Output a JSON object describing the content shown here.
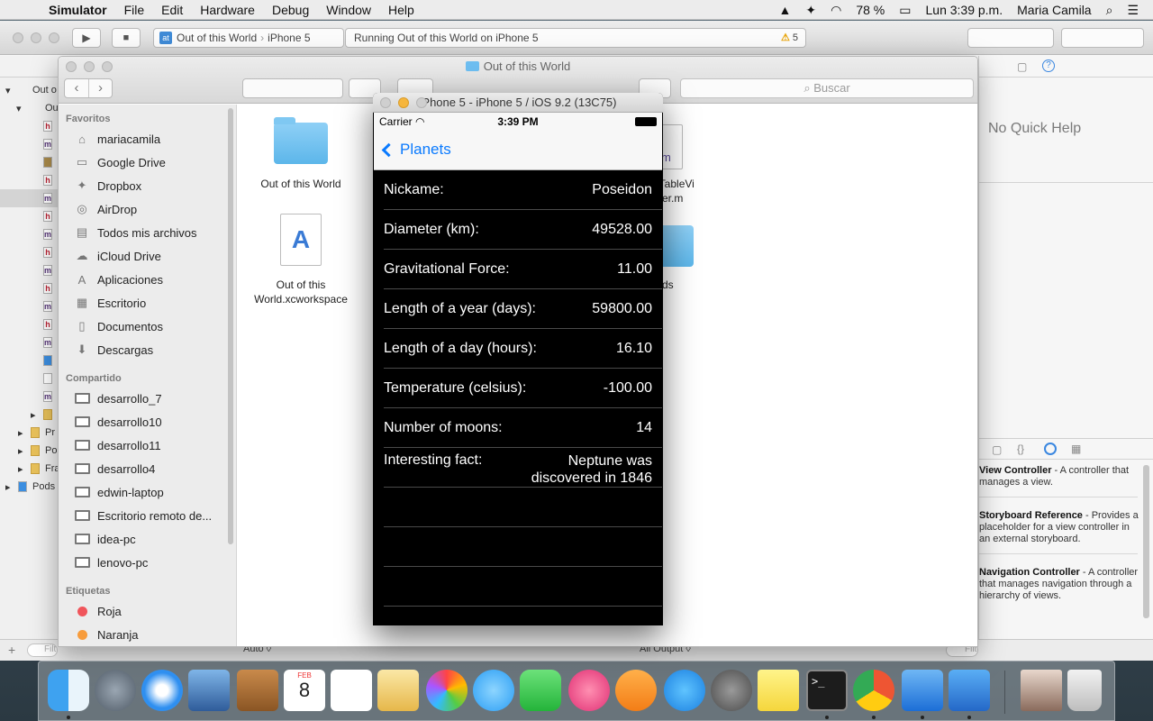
{
  "menubar": {
    "app": "Simulator",
    "items": [
      "File",
      "Edit",
      "Hardware",
      "Debug",
      "Window",
      "Help"
    ],
    "battery": "78 %",
    "clock": "Lun 3:39 p.m.",
    "user": "Maria Camila"
  },
  "xcode": {
    "scheme_target": "Out of this World",
    "scheme_device": "iPhone 5",
    "activity": "Running Out of this World on iPhone 5",
    "warnings": "5",
    "nav_labels": [
      "Out o",
      "Ou",
      "Pr",
      "Po",
      "Fra",
      "Pods"
    ],
    "quick_help": "No Quick Help",
    "filter_placeholder": "Filter",
    "bottom_auto": "Auto ◊",
    "bottom_output": "All Output ◊",
    "library": [
      {
        "title": "View Controller",
        "desc": " - A controller that manages a view."
      },
      {
        "title": "Storyboard Reference",
        "desc": " - Provides a placeholder for a view controller in an external storyboard."
      },
      {
        "title": "Navigation Controller",
        "desc": " - A controller that manages navigation through a hierarchy of views."
      }
    ]
  },
  "finder": {
    "title": "Out of this World",
    "search_placeholder": "Buscar",
    "sections": {
      "favorites": "Favoritos",
      "shared": "Compartido",
      "tags": "Etiquetas"
    },
    "favorites": [
      "mariacamila",
      "Google Drive",
      "Dropbox",
      "AirDrop",
      "Todos mis archivos",
      "iCloud Drive",
      "Aplicaciones",
      "Escritorio",
      "Documentos",
      "Descargas"
    ],
    "shared": [
      "desarrollo_7",
      "desarrollo10",
      "desarrollo11",
      "desarrollo4",
      "edwin-laptop",
      "Escritorio remoto de...",
      "idea-pc",
      "lenovo-pc"
    ],
    "tags": [
      "Roja",
      "Naranja"
    ],
    "files": {
      "folder1": "Out of this World",
      "workspace_line1": "Out of this",
      "workspace_line2": "World.xcworkspace",
      "partial_file_line1": "ceTableVi",
      "partial_file_line2": "roller.m",
      "partial_folder": "ds",
      "partial_m": "m"
    }
  },
  "simulator": {
    "title": "iPhone 5 - iPhone 5 / iOS 9.2 (13C75)",
    "carrier": "Carrier",
    "time": "3:39 PM",
    "back_label": "Planets",
    "rows": [
      {
        "key": "Nickame:",
        "value": "Poseidon"
      },
      {
        "key": "Diameter (km):",
        "value": "49528.00"
      },
      {
        "key": "Gravitational Force:",
        "value": "11.00"
      },
      {
        "key": "Length of a year (days):",
        "value": "59800.00"
      },
      {
        "key": "Length of a day (hours):",
        "value": "16.10"
      },
      {
        "key": "Temperature (celsius):",
        "value": "-100.00"
      },
      {
        "key": "Number of moons:",
        "value": "14"
      }
    ],
    "fact_key": "Interesting fact:",
    "fact_value": "Neptune was discovered in 1846"
  },
  "dock": {
    "calendar_month": "FEB",
    "calendar_day": "8",
    "terminal_prompt": ">_"
  }
}
